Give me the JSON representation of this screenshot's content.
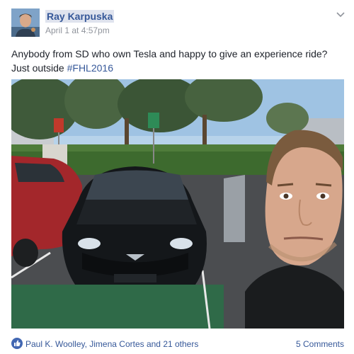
{
  "post": {
    "author": "Ray Karpuska",
    "timestamp": "April 1 at 4:57pm",
    "text_before": "Anybody from SD who own Tesla and happy to give an experience ride? Just outside ",
    "hashtag": "#FHL2016",
    "photo_icon": "selfie-with-tesla-photo",
    "options_icon": "chevron-down-icon"
  },
  "footer": {
    "reaction_icon": "like-icon",
    "likers": "Paul K. Woolley, Jimena Cortes and 21 others",
    "comments": "5 Comments"
  },
  "colors": {
    "link": "#365899",
    "meta": "#90949c",
    "text": "#1d2129",
    "like": "#4267b2"
  }
}
